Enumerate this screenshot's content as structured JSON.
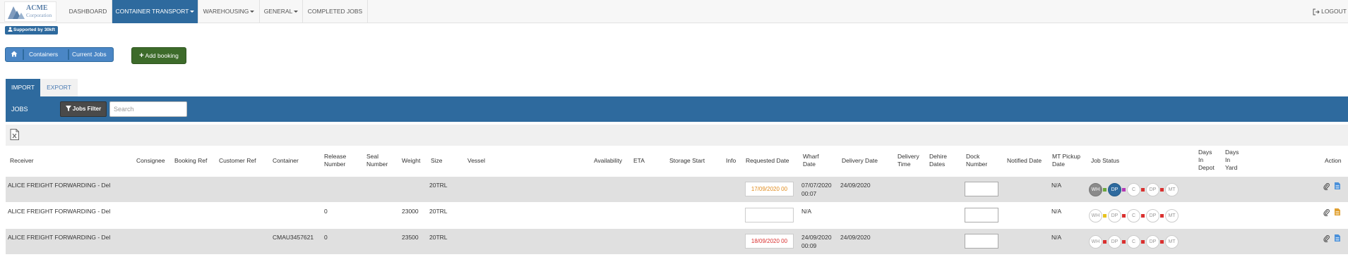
{
  "brand": {
    "line1": "ACME",
    "line2": "Corporation"
  },
  "nav": {
    "items": [
      {
        "label": "DASHBOARD"
      },
      {
        "label": "CONTAINER TRANSPORT"
      },
      {
        "label": "WAREHOUSING"
      },
      {
        "label": "GENERAL"
      },
      {
        "label": "COMPLETED JOBS"
      }
    ],
    "logout": "LOGOUT"
  },
  "supported": "Supported by 30kft",
  "breadcrumb": [
    "Containers",
    "Current Jobs"
  ],
  "add_booking": "Add booking",
  "tabs": [
    "IMPORT",
    "EXPORT"
  ],
  "jobs": {
    "title": "JOBS",
    "filter": "Jobs Filter",
    "search_placeholder": "Search"
  },
  "table": {
    "headers": {
      "receiver": "Receiver",
      "consignee": "Consignee",
      "booking_ref": "Booking Ref",
      "customer_ref": "Customer Ref",
      "container": "Container",
      "release_number": "Release Number",
      "seal_number": "Seal Number",
      "weight": "Weight",
      "size": "Size",
      "vessel": "Vessel",
      "availability": "Availability",
      "eta": "ETA",
      "storage_start": "Storage Start",
      "info": "Info",
      "requested_date": "Requested Date",
      "wharf_date": "Wharf Date",
      "delivery_date": "Delivery Date",
      "delivery_time": "Delivery Time",
      "dehire_dates": "Dehire Dates",
      "dock_number": "Dock Number",
      "notified_date": "Notified Date",
      "mt_pickup_date": "MT Pickup Date",
      "job_status": "Job Status",
      "days_in_depot": "Days In Depot",
      "days_in_yard": "Days In Yard",
      "action": "Action"
    },
    "rows": [
      {
        "receiver": "ALICE FREIGHT FORWARDING - Del",
        "container": "",
        "release_number": "",
        "weight": "",
        "size": "20TRL",
        "requested_date": "17/09/2020 00",
        "requested_color": "#e08a1a",
        "wharf_date": "07/07/2020",
        "wharf_time": "00:07",
        "delivery_date": "24/09/2020",
        "mt_pickup_date": "N/A",
        "status": [
          "WH",
          "DP",
          "C",
          "DP",
          "MT"
        ],
        "status_active": [
          true,
          true,
          false,
          false,
          false
        ],
        "link_colors": [
          "#6aa83a",
          "#b43ab4",
          "#d9302f",
          "#d9302f"
        ],
        "doc_icon_color": "#4a90d9"
      },
      {
        "receiver": "ALICE FREIGHT FORWARDING - Del",
        "container": "",
        "release_number": "0",
        "weight": "23000",
        "size": "20TRL",
        "requested_date": "",
        "requested_color": "#333333",
        "wharf_date": "N/A",
        "wharf_time": "",
        "delivery_date": "",
        "mt_pickup_date": "N/A",
        "status": [
          "WH",
          "DP",
          "C",
          "DP",
          "MT"
        ],
        "status_active": [
          false,
          false,
          false,
          false,
          false
        ],
        "link_colors": [
          "#e6c21f",
          "#d9302f",
          "#d9302f",
          "#d9302f"
        ],
        "doc_icon_color": "#e0a030"
      },
      {
        "receiver": "ALICE FREIGHT FORWARDING - Del",
        "container": "CMAU3457621",
        "release_number": "0",
        "weight": "23500",
        "size": "20TRL",
        "requested_date": "18/09/2020 00",
        "requested_color": "#d9302f",
        "wharf_date": "24/09/2020",
        "wharf_time": "00:09",
        "delivery_date": "24/09/2020",
        "mt_pickup_date": "N/A",
        "status": [
          "WH",
          "DP",
          "C",
          "DP",
          "MT"
        ],
        "status_active": [
          false,
          false,
          false,
          false,
          false
        ],
        "link_colors": [
          "#d9302f",
          "#d9302f",
          "#d9302f",
          "#d9302f"
        ],
        "doc_icon_color": "#4a90d9"
      }
    ]
  }
}
